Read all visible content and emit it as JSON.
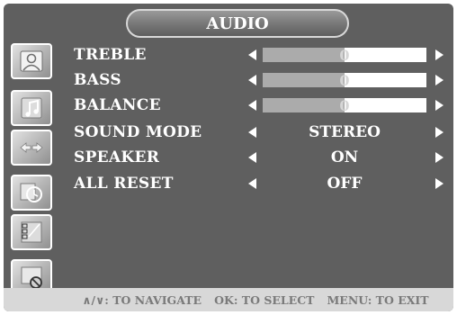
{
  "menu": {
    "title": "AUDIO"
  },
  "sidebar": {
    "icons": [
      {
        "name": "picture-icon",
        "active": false
      },
      {
        "name": "audio-icon",
        "active": true
      },
      {
        "name": "channel-icon",
        "active": false
      },
      {
        "name": "timer-icon",
        "active": false
      },
      {
        "name": "setup-icon",
        "active": false
      },
      {
        "name": "lock-icon",
        "active": false
      }
    ]
  },
  "rows": [
    {
      "label": "TREBLE",
      "type": "slider",
      "value": "0",
      "level": 0.5
    },
    {
      "label": "BASS",
      "type": "slider",
      "value": "0",
      "level": 0.5
    },
    {
      "label": "BALANCE",
      "type": "slider",
      "value": "0",
      "level": 0.5
    },
    {
      "label": "SOUND MODE",
      "type": "option",
      "value": "STEREO"
    },
    {
      "label": "SPEAKER",
      "type": "option",
      "value": "ON"
    },
    {
      "label": "ALL RESET",
      "type": "option",
      "value": "OFF"
    }
  ],
  "footer": {
    "navigate": "∧/∨: TO NAVIGATE",
    "select": "OK: TO SELECT",
    "exit": "MENU: TO EXIT"
  },
  "colors": {
    "panel": "#5f5f5f",
    "slider_track": "#ffffff",
    "slider_fill": "#ababab",
    "footer_bg": "#d8d8d8",
    "text": "#ffffff"
  }
}
